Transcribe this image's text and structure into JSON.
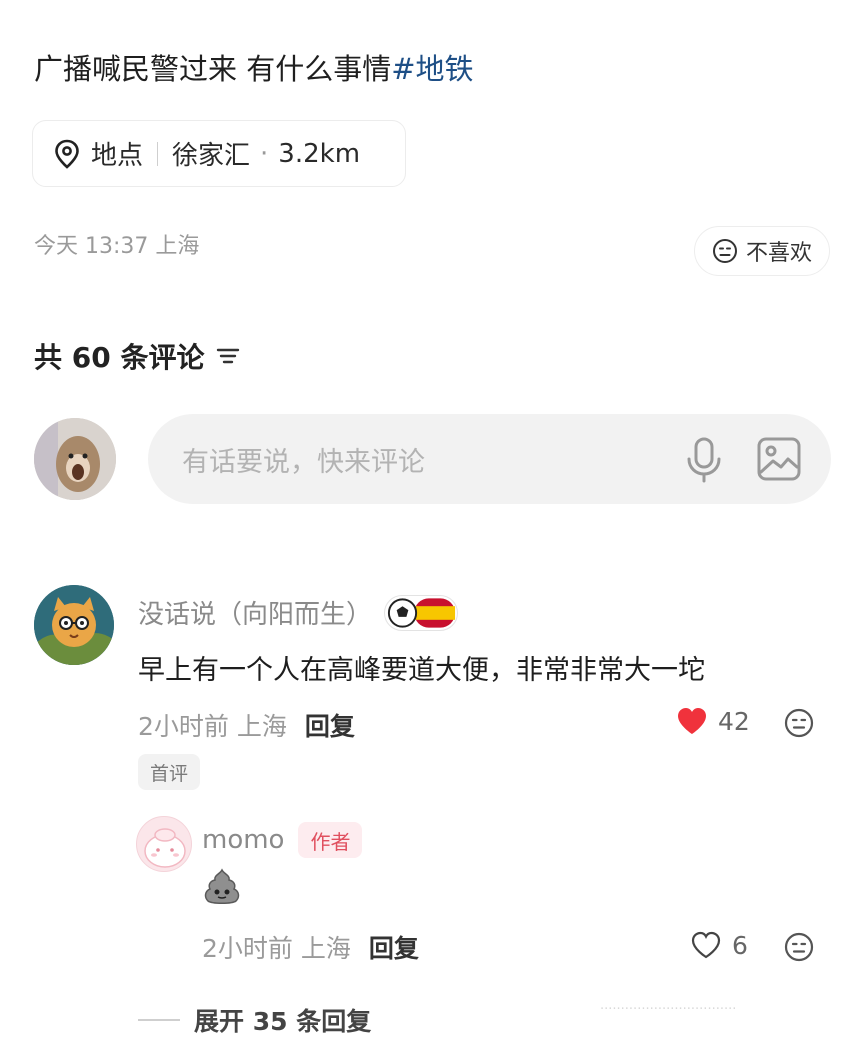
{
  "post": {
    "text": "广播喊民警过来 有什么事情",
    "hashtag": "#地铁",
    "location": {
      "label": "地点",
      "place": "徐家汇",
      "dot": "·",
      "distance": "3.2km"
    },
    "time_location": "今天 13:37 上海",
    "dislike_label": "不喜欢"
  },
  "comments_header": {
    "title": "共 60 条评论"
  },
  "comment_input": {
    "placeholder": "有话要说，快来评论"
  },
  "comments": [
    {
      "username": "没话说（向阳而生）",
      "text": "早上有一个人在高峰要道大便，非常非常大一坨",
      "time": "2小时前",
      "location": "上海",
      "reply_label": "回复",
      "likes": "42",
      "tag": "首评",
      "replies": [
        {
          "username": "momo",
          "author_tag": "作者",
          "time": "2小时前",
          "location": "上海",
          "reply_label": "回复",
          "likes": "6"
        }
      ],
      "expand_label": "展开 35 条回复"
    }
  ],
  "colors": {
    "hashtag": "#1e4f86",
    "like_red": "#f0323c",
    "author_tag": "#e0505f"
  },
  "watermark": "·································"
}
